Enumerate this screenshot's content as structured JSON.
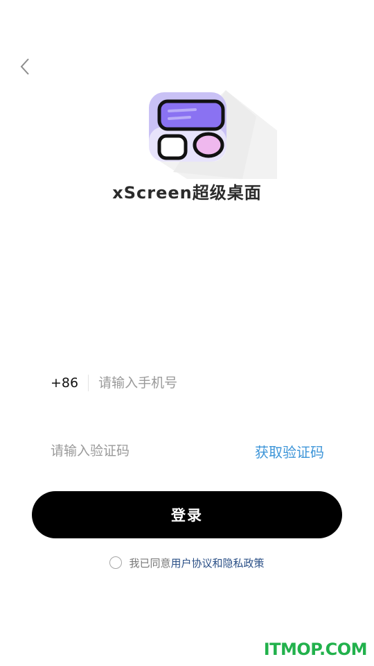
{
  "header": {
    "back_icon": "chevron-left-icon"
  },
  "logo": {
    "icon": "xscreen-widget-logo-icon",
    "colors": {
      "purple": "#8a72f2",
      "pink": "#efb8ee",
      "shadow_purple": "#c9c1f5",
      "outline": "#111111"
    }
  },
  "app_name": "xScreen超级桌面",
  "phone": {
    "country_code": "+86",
    "placeholder": "请输入手机号",
    "value": ""
  },
  "code": {
    "placeholder": "请输入验证码",
    "value": "",
    "get_code_label": "获取验证码"
  },
  "login": {
    "label": "登录"
  },
  "agreement": {
    "prefix": "我已同意",
    "link": "用户协议和隐私政策",
    "checked": false
  },
  "watermark": "ITMOP.COM",
  "colors": {
    "accent": "#3d95d8",
    "button": "#000000",
    "link": "#2a4f86",
    "watermark": "#22b14c"
  }
}
